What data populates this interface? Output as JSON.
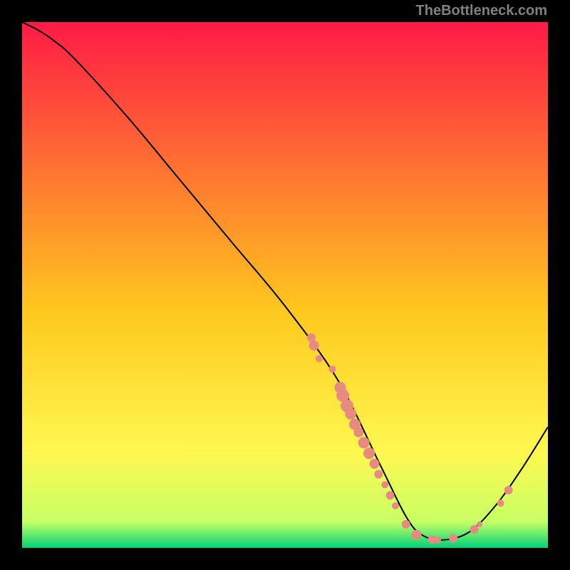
{
  "attribution": "TheBottleneck.com",
  "chart_data": {
    "type": "line",
    "title": "",
    "xlabel": "",
    "ylabel": "",
    "xlim": [
      0,
      100
    ],
    "ylim": [
      0,
      100
    ],
    "grid": false,
    "legend": false,
    "background_gradient": {
      "top": "#ff1a46",
      "upper_mid": "#ffc81e",
      "lower_mid": "#fff850",
      "near_bottom": "#c8ff64",
      "bottom": "#00d278"
    },
    "series": [
      {
        "name": "bottleneck-curve",
        "color": "#000000",
        "x": [
          0,
          3,
          6,
          10,
          20,
          30,
          40,
          50,
          60,
          68,
          73,
          76,
          80,
          85,
          90,
          95,
          100
        ],
        "y": [
          100,
          98.5,
          96.5,
          93,
          82,
          70,
          58,
          46,
          32,
          16,
          6,
          2.5,
          1.5,
          3,
          8,
          15,
          23
        ]
      }
    ],
    "markers": {
      "name": "highlighted-points",
      "color": "#e68a82",
      "shape": "circle",
      "points": [
        {
          "x": 55,
          "y": 40,
          "r": 6
        },
        {
          "x": 55.5,
          "y": 38.5,
          "r": 7
        },
        {
          "x": 56.5,
          "y": 36,
          "r": 5
        },
        {
          "x": 59,
          "y": 34,
          "r": 5
        },
        {
          "x": 60.5,
          "y": 30.5,
          "r": 8
        },
        {
          "x": 61,
          "y": 29,
          "r": 9
        },
        {
          "x": 61.8,
          "y": 27,
          "r": 9
        },
        {
          "x": 62.5,
          "y": 25.5,
          "r": 8
        },
        {
          "x": 63.3,
          "y": 23.5,
          "r": 8
        },
        {
          "x": 64,
          "y": 22,
          "r": 7
        },
        {
          "x": 65,
          "y": 20,
          "r": 8
        },
        {
          "x": 66,
          "y": 18,
          "r": 8
        },
        {
          "x": 67,
          "y": 16,
          "r": 7
        },
        {
          "x": 67.8,
          "y": 14,
          "r": 6
        },
        {
          "x": 69,
          "y": 12,
          "r": 5
        },
        {
          "x": 70,
          "y": 10,
          "r": 6
        },
        {
          "x": 71,
          "y": 8,
          "r": 5
        },
        {
          "x": 73,
          "y": 4.5,
          "r": 6
        },
        {
          "x": 75,
          "y": 2.5,
          "r": 7
        },
        {
          "x": 78,
          "y": 1.6,
          "r": 6
        },
        {
          "x": 79,
          "y": 1.5,
          "r": 5
        },
        {
          "x": 82,
          "y": 1.8,
          "r": 6
        },
        {
          "x": 86,
          "y": 3.5,
          "r": 6
        },
        {
          "x": 87,
          "y": 4.5,
          "r": 4
        },
        {
          "x": 91,
          "y": 8.5,
          "r": 5
        },
        {
          "x": 92.5,
          "y": 11,
          "r": 6
        }
      ]
    }
  }
}
